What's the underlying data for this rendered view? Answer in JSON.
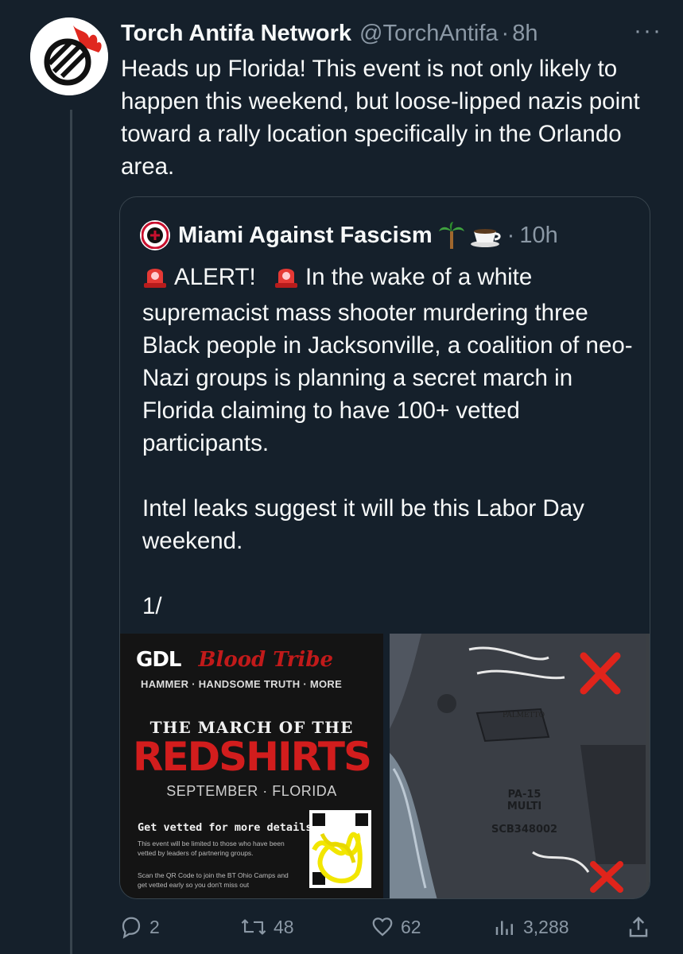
{
  "tweet": {
    "author_name": "Torch Antifa Network",
    "author_handle": "@TorchAntifa",
    "separator": "·",
    "time": "8h",
    "more": "···",
    "text": "Heads up Florida! This event is not only likely to happen this weekend, but loose-lipped nazis point toward a rally location specifically in the Orlando area."
  },
  "quote": {
    "author_name": "Miami Against Fascism",
    "emojis": [
      "palm-tree",
      "coffee-cup"
    ],
    "separator": "·",
    "time": "10h",
    "alert_word": "ALERT!",
    "text_rest": "In the wake of a white supremacist mass shooter murdering three Black people in Jacksonville, a coalition of neo-Nazi groups is planning a secret march in Florida claiming to have 100+ vetted participants.",
    "paragraph2": "Intel leaks suggest it will be this Labor Day weekend.",
    "paragraph3": "1/",
    "media": {
      "poster": {
        "logo_left": "GDL",
        "logo_right": "Blood Tribe",
        "tagline": "HAMMER · HANDSOME TRUTH · MORE",
        "headline": "THE MARCH OF THE",
        "headline_big": "REDSHIRTS",
        "date": "SEPTEMBER · FLORIDA",
        "vetted": "Get vetted for more details!",
        "fine_print_1": "This event will be limited to those who have been vetted by leaders of partnering groups.",
        "fine_print_2": "Scan the QR Code to join the BT Ohio Camps and get vetted early so you don't miss out"
      },
      "photo": {
        "stamp": "PALMETTO",
        "marking_1": "PA-15",
        "marking_2": "MULTI",
        "marking_3": "SCB348002"
      }
    }
  },
  "actions": {
    "replies": "2",
    "reposts": "48",
    "likes": "62",
    "views": "3,288"
  },
  "colors": {
    "background": "#15202b",
    "secondary_text": "#8b98a5",
    "border": "#38444d",
    "poster_red": "#d21d1d"
  }
}
